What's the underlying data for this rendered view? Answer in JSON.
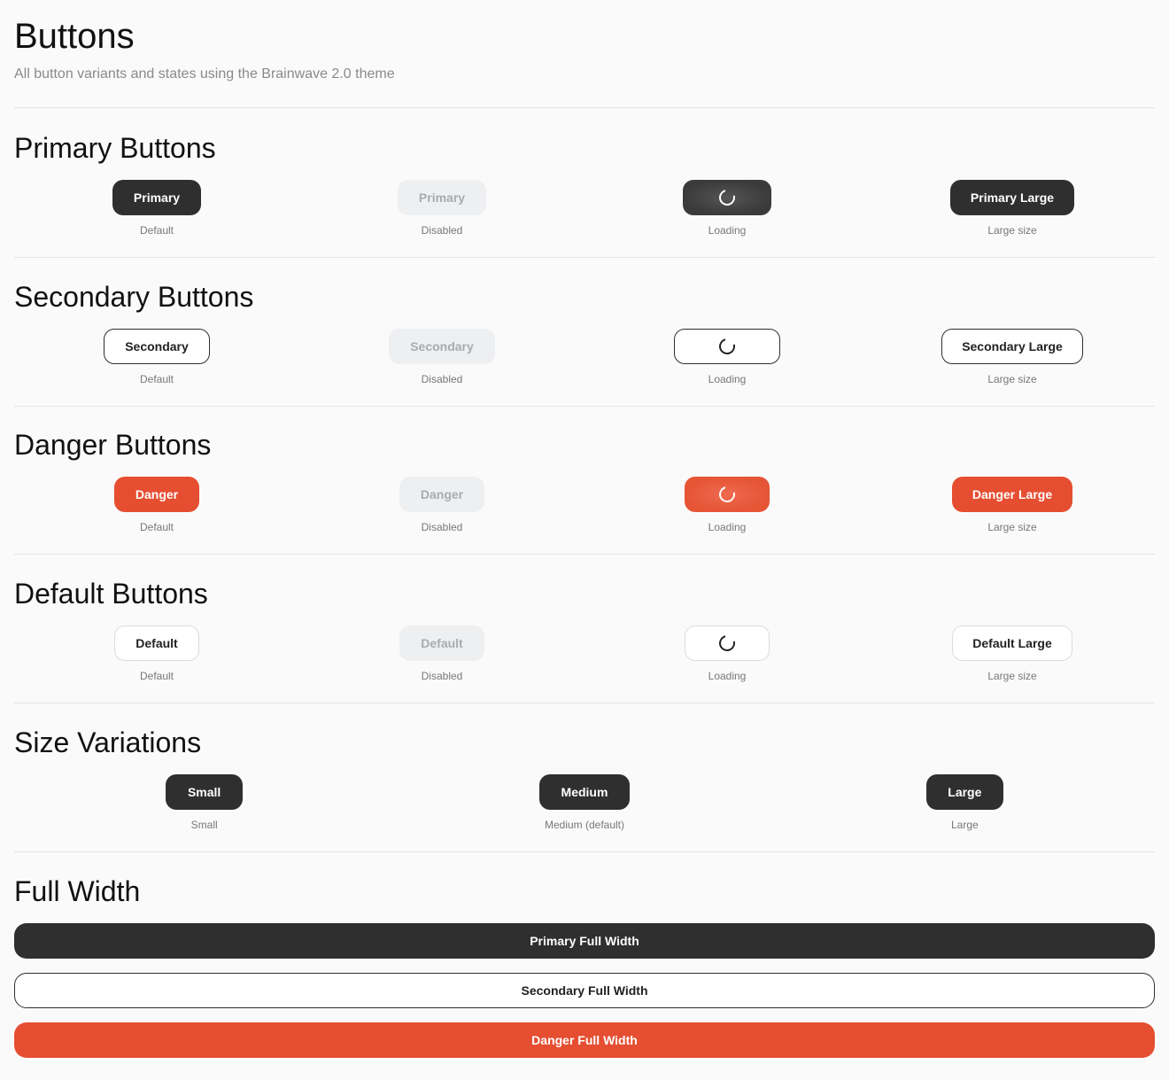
{
  "header": {
    "title": "Buttons",
    "subtitle": "All button variants and states using the Brainwave 2.0 theme"
  },
  "colors": {
    "primary": "#2f2f2f",
    "danger": "#e54e31",
    "disabled_bg": "#eeeff1",
    "disabled_text": "#a8abb0",
    "background": "#fafafa"
  },
  "primary": {
    "title": "Primary Buttons",
    "default_label": "Primary",
    "default_caption": "Default",
    "disabled_label": "Primary",
    "disabled_caption": "Disabled",
    "loading_caption": "Loading",
    "large_label": "Primary Large",
    "large_caption": "Large size"
  },
  "secondary": {
    "title": "Secondary Buttons",
    "default_label": "Secondary",
    "default_caption": "Default",
    "disabled_label": "Secondary",
    "disabled_caption": "Disabled",
    "loading_caption": "Loading",
    "large_label": "Secondary Large",
    "large_caption": "Large size"
  },
  "danger": {
    "title": "Danger Buttons",
    "default_label": "Danger",
    "default_caption": "Default",
    "disabled_label": "Danger",
    "disabled_caption": "Disabled",
    "loading_caption": "Loading",
    "large_label": "Danger Large",
    "large_caption": "Large size"
  },
  "default": {
    "title": "Default Buttons",
    "default_label": "Default",
    "default_caption": "Default",
    "disabled_label": "Default",
    "disabled_caption": "Disabled",
    "loading_caption": "Loading",
    "large_label": "Default Large",
    "large_caption": "Large size"
  },
  "sizes": {
    "title": "Size Variations",
    "small_label": "Small",
    "small_caption": "Small",
    "medium_label": "Medium",
    "medium_caption": "Medium (default)",
    "large_label": "Large",
    "large_caption": "Large"
  },
  "full_width": {
    "title": "Full Width",
    "primary_label": "Primary Full Width",
    "secondary_label": "Secondary Full Width",
    "danger_label": "Danger Full Width"
  }
}
